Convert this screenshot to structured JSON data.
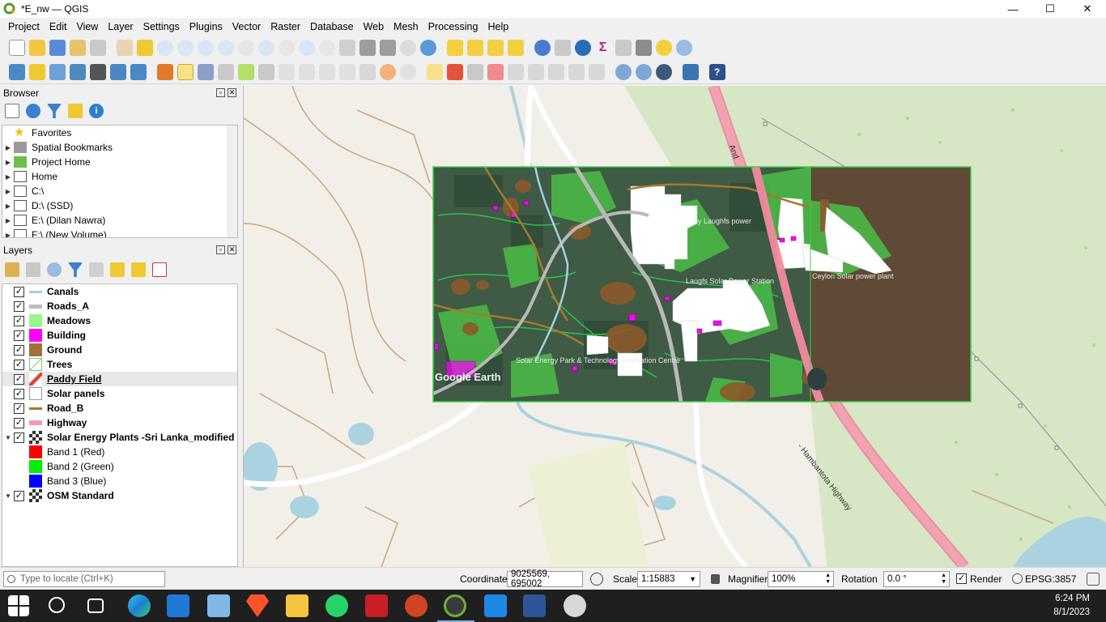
{
  "window": {
    "title": "*E_nw — QGIS",
    "minimize": "—",
    "maximize": "☐",
    "close": "✕"
  },
  "menu": [
    "Project",
    "Edit",
    "View",
    "Layer",
    "Settings",
    "Plugins",
    "Vector",
    "Raster",
    "Database",
    "Web",
    "Mesh",
    "Processing",
    "Help"
  ],
  "browser": {
    "title": "Browser",
    "items": [
      {
        "label": "Favorites",
        "icon": "star-icon"
      },
      {
        "label": "Spatial Bookmarks",
        "icon": "bookmark-icon"
      },
      {
        "label": "Project Home",
        "icon": "project-home-icon"
      },
      {
        "label": "Home",
        "icon": "home-icon"
      },
      {
        "label": "C:\\",
        "icon": "folder-icon"
      },
      {
        "label": "D:\\ (SSD)",
        "icon": "folder-icon"
      },
      {
        "label": "E:\\ (Dilan Nawra)",
        "icon": "folder-icon"
      },
      {
        "label": "F:\\ (New Volume)",
        "icon": "folder-icon"
      }
    ]
  },
  "layers": {
    "title": "Layers",
    "items": [
      {
        "name": "Canals",
        "color": "#a6cee3"
      },
      {
        "name": "Roads_A",
        "color": "#bdbdbd"
      },
      {
        "name": "Meadows",
        "color": "#98f58a"
      },
      {
        "name": "Building",
        "color": "#ff00ff"
      },
      {
        "name": "Ground",
        "color": "#a0703a"
      },
      {
        "name": "Trees",
        "color": "#6fcf6f"
      },
      {
        "name": "Paddy Field",
        "color": "#e0442f"
      },
      {
        "name": "Solar panels",
        "color": "#ffffff"
      },
      {
        "name": "Road_B",
        "color": "#a57a2c"
      },
      {
        "name": "Highway",
        "color": "#f59bb0"
      },
      {
        "name": "Solar Energy Plants -Sri Lanka_modified",
        "color": "#333333"
      },
      {
        "name": "OSM Standard",
        "color": "#333333"
      }
    ],
    "bands": [
      {
        "name": "Band 1 (Red)",
        "color": "#ff0000"
      },
      {
        "name": "Band 2 (Green)",
        "color": "#00ee00"
      },
      {
        "name": "Band 3 (Blue)",
        "color": "#0000ff"
      }
    ]
  },
  "map": {
    "label_road": "And",
    "label_highway": "- Hambantota Highway",
    "label_park1": "Solar Energy Park & Technology Innovation Centre",
    "label_park2": "Laugfs Solar Power Station",
    "label_plant": "Ceylon Solar power plant",
    "label_watermark": "Google Earth",
    "label_laughfs": "by Laughfs power"
  },
  "status": {
    "locator_placeholder": "Type to locate (Ctrl+K)",
    "coordinate_label": "Coordinate",
    "coordinate_value": "9025569, 695002",
    "scale_label": "Scale",
    "scale_value": "1:15883",
    "magnifier_label": "Magnifier",
    "magnifier_value": "100%",
    "rotation_label": "Rotation",
    "rotation_value": "0.0 °",
    "render_label": "Render",
    "crs": "EPSG:3857"
  },
  "taskbar": {
    "time": "6:24 PM",
    "date": "8/1/2023"
  }
}
